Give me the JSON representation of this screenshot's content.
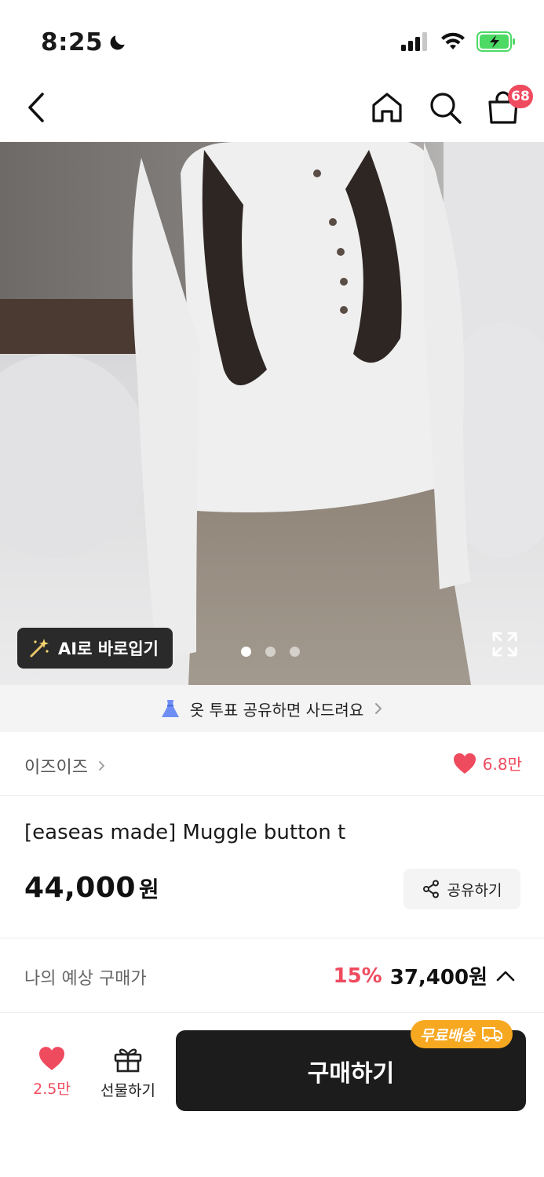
{
  "status_bar": {
    "time": "8:25"
  },
  "nav": {
    "cart_count": "68"
  },
  "hero": {
    "ai_try_on_label": "AI로 바로입기",
    "slide_count": 3,
    "active_slide": 1
  },
  "promo_banner": {
    "text": "옷 투표 공유하면 사드려요"
  },
  "brand": {
    "name": "이즈이즈",
    "like_count": "6.8만"
  },
  "product": {
    "title": "[easeas made] Muggle button t",
    "price": "44,000",
    "currency": "원",
    "share_label": "공유하기"
  },
  "expected_price": {
    "label": "나의 예상 구매가",
    "discount": "15%",
    "final_price": "37,400원"
  },
  "bottom_bar": {
    "like_count": "2.5만",
    "gift_label": "선물하기",
    "buy_label": "구매하기",
    "free_shipping_label": "무료배송"
  },
  "colors": {
    "accent": "#ef4b5f",
    "buy_button": "#1c1c1c",
    "free_shipping": "#f7a821"
  }
}
